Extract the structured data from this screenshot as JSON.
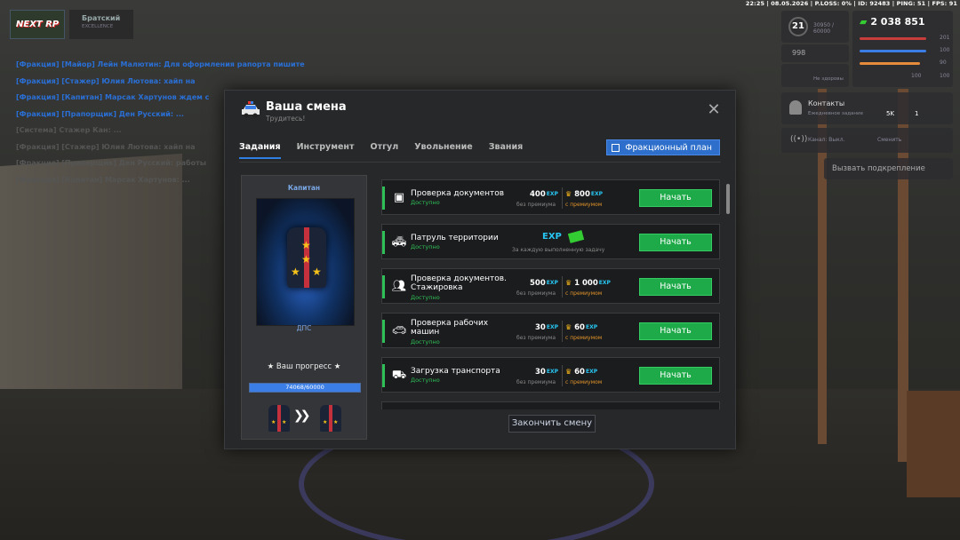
{
  "topinfo": "22:25 | 08.05.2026 | P.LOSS: 0% | ID: 92483 | PING: 51 | FPS: 91",
  "brand": {
    "logo": "NEXT RP",
    "server": "Братский",
    "server_sub": "EXCELLENCE"
  },
  "chat": [
    "[Фракция] [Майор] Лейн Малютин: Для оформления рапорта пишите",
    "[Фракция] [Стажер] Юлия Лютова: хайп на",
    "[Фракция] [Капитан] Марсак Хартунов ждем с",
    "[Фракция] [Прапорщик] Ден Русский: ...",
    "[Система] Стажер Кан: ...",
    "[Фракция] [Стажер] Юлия Лютова: хайп на",
    "[Фракция] [Прапорщик] Ден Русский: работы",
    "[Фракция] [Капитан] Марсак Хартунов: ..."
  ],
  "hud": {
    "level": "21",
    "level_progress": "30950 / 60000",
    "money": "2 038 851",
    "stat_201": "201",
    "stat_100a": "100",
    "stat_90": "90",
    "stat_100b": "100",
    "stat_100c": "100",
    "reputation": "998",
    "health_label": "Не здоровы",
    "contacts": "Контакты",
    "contacts_sub": "Ежедневное задание",
    "sk": "5K",
    "one": "1",
    "channel": "Канал: Выкл.",
    "change": "Сменить",
    "backup": "Вызвать подкрепление"
  },
  "modal": {
    "title": "Ваша смена",
    "subtitle": "Трудитесь!",
    "tabs": [
      "Задания",
      "Инструмент",
      "Отгул",
      "Увольнение",
      "Звания"
    ],
    "plan_button": "Фракционный план",
    "end_button": "Закончить смену"
  },
  "rank": {
    "title": "Капитан",
    "department": "ДПС",
    "progress_label": "★ Ваш прогресс ★",
    "progress_text": "74068/60000",
    "progress_fraction": 1.0
  },
  "tasks": [
    {
      "name": "Проверка документов",
      "status": "Доступно",
      "base": "400",
      "base_unit": "EXP",
      "base_note": "без премиума",
      "premium": "800",
      "premium_unit": "EXP",
      "premium_note": "с премиумом",
      "button": "Начать",
      "icon": "passport-icon"
    },
    {
      "name": "Патруль территории",
      "status": "Доступно",
      "reward_note": "За каждую выполненную задачу",
      "exp": "EXP",
      "button": "Начать",
      "icon": "police-car-icon"
    },
    {
      "name": "Проверка документов. Стажировка",
      "status": "Доступно",
      "base": "500",
      "base_unit": "EXP",
      "base_note": "без премиума",
      "premium": "1 000",
      "premium_unit": "EXP",
      "premium_note": "с премиумом",
      "button": "Начать",
      "icon": "people-icon"
    },
    {
      "name": "Проверка рабочих машин",
      "status": "Доступно",
      "base": "30",
      "base_unit": "EXP",
      "base_note": "без премиума",
      "premium": "60",
      "premium_unit": "EXP",
      "premium_note": "с премиумом",
      "button": "Начать",
      "icon": "car-check-icon"
    },
    {
      "name": "Загрузка транспорта",
      "status": "Доступно",
      "base": "30",
      "base_unit": "EXP",
      "base_note": "без премиума",
      "premium": "60",
      "premium_unit": "EXP",
      "premium_note": "с премиумом",
      "button": "Начать",
      "icon": "loader-icon"
    }
  ],
  "colors": {
    "accent": "#2e7fe0",
    "start_green": "#1faa4a",
    "exp_cyan": "#27c6f2",
    "premium_gold": "#f2b31b"
  }
}
